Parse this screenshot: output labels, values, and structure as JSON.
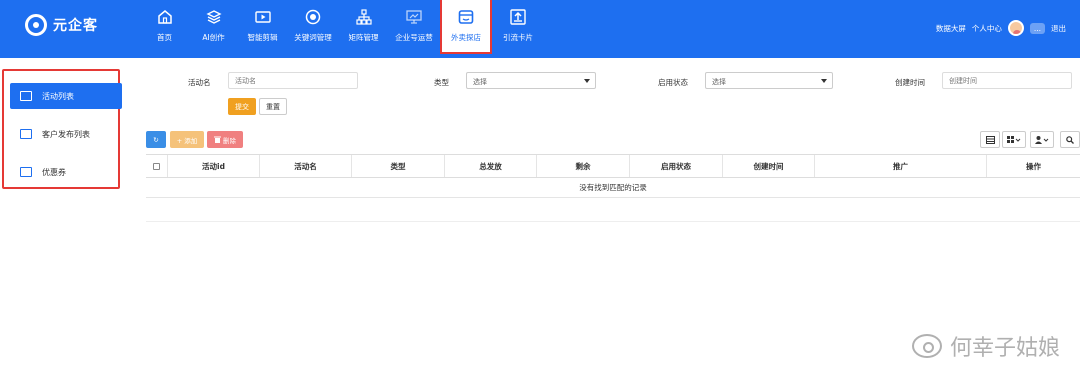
{
  "brand": {
    "name": "元企客"
  },
  "nav": {
    "items": [
      {
        "label": "首页",
        "icon": "home-icon"
      },
      {
        "label": "AI创作",
        "icon": "layers-icon"
      },
      {
        "label": "智能剪辑",
        "icon": "video-icon"
      },
      {
        "label": "关键词管理",
        "icon": "target-icon"
      },
      {
        "label": "矩阵管理",
        "icon": "hierarchy-icon"
      },
      {
        "label": "企业号运营",
        "icon": "presentation-icon"
      },
      {
        "label": "外卖探店",
        "icon": "store-icon"
      },
      {
        "label": "引流卡片",
        "icon": "upload-card-icon"
      }
    ]
  },
  "user": {
    "dashboard": "数据大屏",
    "center": "个人中心",
    "name": "...",
    "logout": "退出"
  },
  "sidebar": {
    "items": [
      {
        "label": "活动列表",
        "icon": "list-icon"
      },
      {
        "label": "客户发布列表",
        "icon": "table-icon"
      },
      {
        "label": "优惠券",
        "icon": "coupon-icon"
      }
    ]
  },
  "filters": {
    "name_label": "活动名",
    "name_placeholder": "活动名",
    "type_label": "类型",
    "type_value": "选择",
    "status_label": "启用状态",
    "status_value": "选择",
    "created_label": "创建时间",
    "created_placeholder": "创建时间",
    "submit": "提交",
    "reset": "重置"
  },
  "toolbar": {
    "refresh": "↻",
    "add": "+ 添加",
    "delete": "删除"
  },
  "table": {
    "columns": [
      "活动id",
      "活动名",
      "类型",
      "总发放",
      "剩余",
      "启用状态",
      "创建时间",
      "推广",
      "操作"
    ],
    "empty_text": "没有找到匹配的记录"
  },
  "watermark": {
    "text": "何幸子姑娘"
  },
  "colors": {
    "primary": "#1e6ff0",
    "highlight_border": "#e53935",
    "submit": "#f0a020",
    "delete": "#f08080",
    "add": "#f5c27a",
    "refresh": "#3a8ee6"
  }
}
